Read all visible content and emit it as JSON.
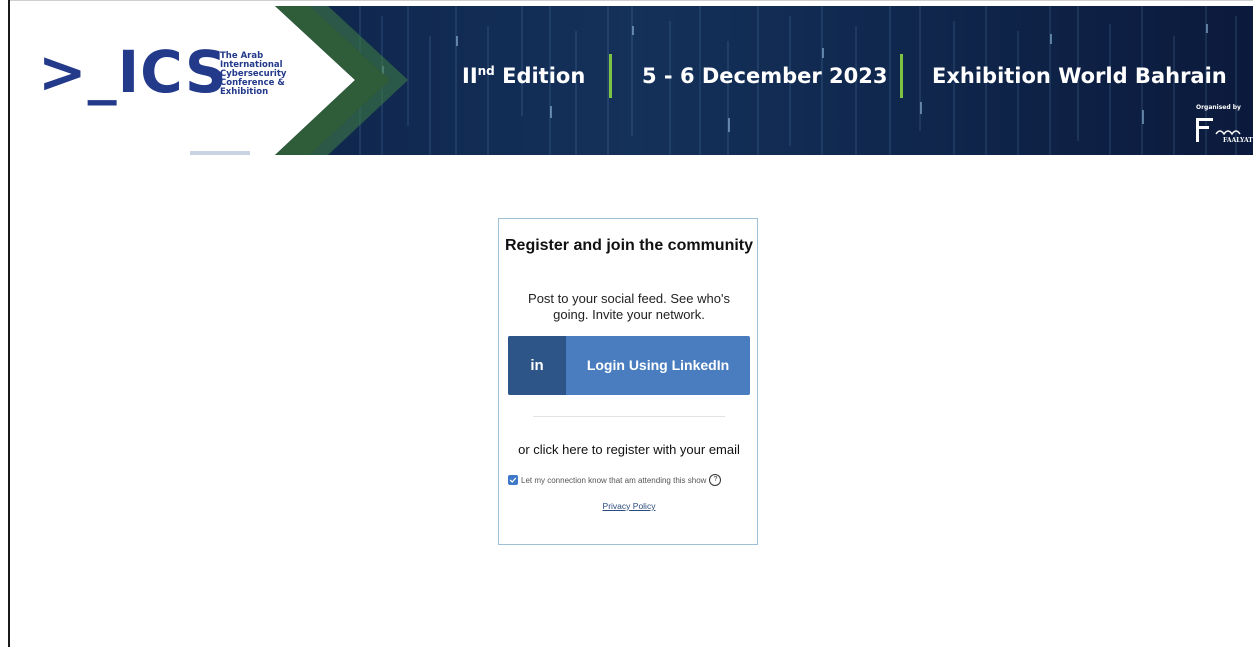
{
  "banner": {
    "logo_text": ">_ICS",
    "logo_subtitle": "The Arab\nInternational\nCybersecurity\nConference &\nExhibition",
    "edition_main": "II",
    "edition_sup": "nd",
    "edition_word": " Edition",
    "dates": "5 - 6 December 2023",
    "venue": "Exhibition World Bahrain",
    "organised_by": "Organised by",
    "organiser_name": "FAALYAT",
    "accent_color": "#7cc243",
    "brand_color": "#233a8b"
  },
  "card": {
    "title": "Register and join the community",
    "subtitle": "Post to your social feed. See who's going. Invite your network.",
    "linkedin_icon": "in",
    "linkedin_label": "Login Using LinkedIn",
    "email_link": "or click here to register with your email",
    "consent_checked": true,
    "consent_text": "Let my connection know that am attending this show",
    "privacy_link": "Privacy Policy"
  }
}
